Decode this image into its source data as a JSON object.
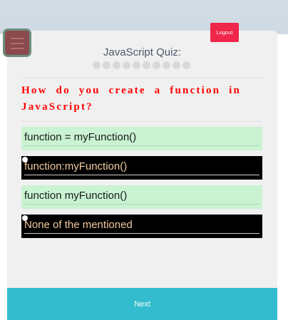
{
  "header": {
    "logout_label": "Logout",
    "menu_icon": "hamburger-menu-icon"
  },
  "quiz": {
    "title": "JavaScript Quiz:",
    "question": "How do you create a function in JavaScript?",
    "answers": [
      {
        "text": "function = myFunction()",
        "state": "unselected"
      },
      {
        "text": "function:myFunction()",
        "state": "highlighted"
      },
      {
        "text": "function myFunction()",
        "state": "unselected"
      },
      {
        "text": "None of the mentioned",
        "state": "highlighted"
      }
    ]
  },
  "footer": {
    "next_label": "Next"
  },
  "colors": {
    "logout": "#f0264b",
    "question": "#ff0000",
    "answer_light": "#c9f3d3",
    "answer_dark": "#000000",
    "next": "#33bccd"
  }
}
